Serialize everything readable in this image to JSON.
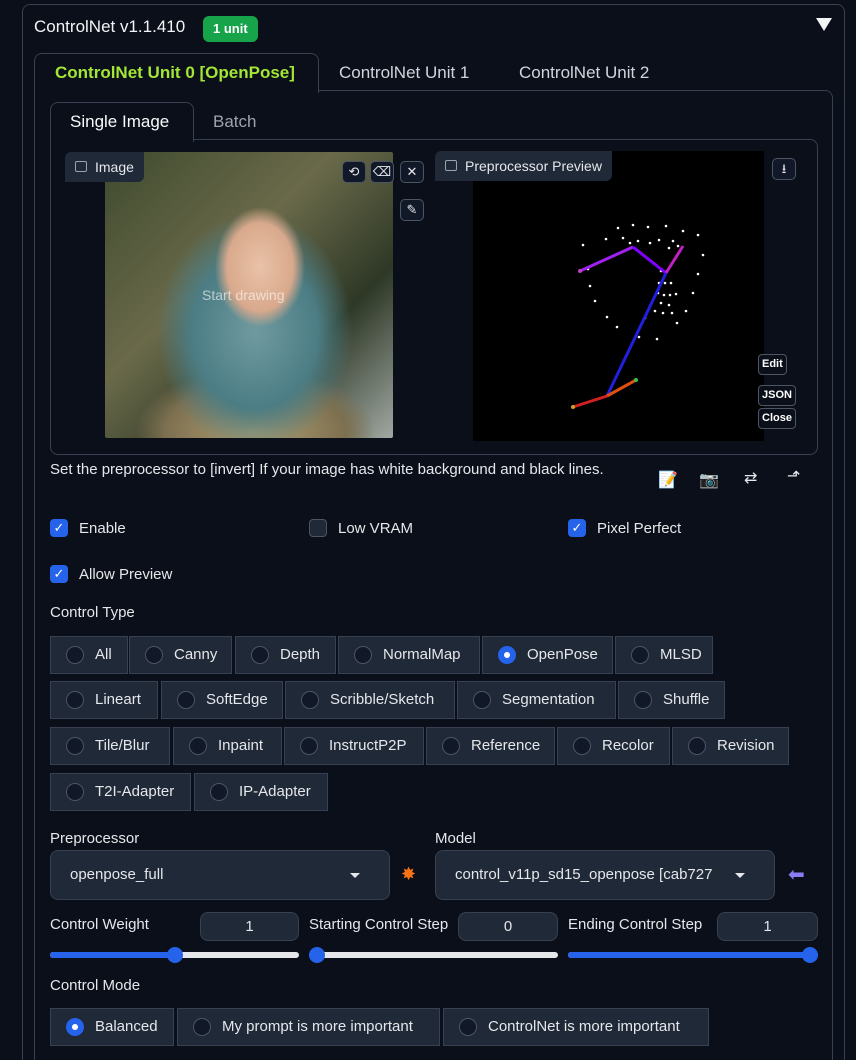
{
  "header": {
    "title": "ControlNet v1.1.410",
    "badge": "1 unit"
  },
  "unit_tabs": [
    "ControlNet Unit 0 [OpenPose]",
    "ControlNet Unit 1",
    "ControlNet Unit 2"
  ],
  "image_tabs": [
    "Single Image",
    "Batch"
  ],
  "image_panel": {
    "label": "Image",
    "overlay": "Start drawing"
  },
  "preview_panel": {
    "label": "Preprocessor Preview",
    "edit": "Edit",
    "json": "JSON",
    "close": "Close"
  },
  "hint": "Set the preprocessor to [invert] If your image has white background and black lines.",
  "options": {
    "enable": {
      "label": "Enable",
      "checked": true
    },
    "low_vram": {
      "label": "Low VRAM",
      "checked": false
    },
    "pixel_perfect": {
      "label": "Pixel Perfect",
      "checked": true
    },
    "allow_preview": {
      "label": "Allow Preview",
      "checked": true
    }
  },
  "control_type": {
    "label": "Control Type",
    "selected": "OpenPose",
    "rows": [
      [
        "All",
        "Canny",
        "Depth",
        "NormalMap",
        "OpenPose",
        "MLSD"
      ],
      [
        "Lineart",
        "SoftEdge",
        "Scribble/Sketch",
        "Segmentation",
        "Shuffle"
      ],
      [
        "Tile/Blur",
        "Inpaint",
        "InstructP2P",
        "Reference",
        "Recolor",
        "Revision"
      ],
      [
        "T2I-Adapter",
        "IP-Adapter"
      ]
    ]
  },
  "preprocessor": {
    "label": "Preprocessor",
    "value": "openpose_full"
  },
  "model": {
    "label": "Model",
    "value": "control_v11p_sd15_openpose [cab727"
  },
  "weights": {
    "control_weight": {
      "label": "Control Weight",
      "value": "1",
      "fraction": 0.5
    },
    "start_step": {
      "label": "Starting Control Step",
      "value": "0",
      "fraction": 0.0
    },
    "end_step": {
      "label": "Ending Control Step",
      "value": "1",
      "fraction": 1.0
    }
  },
  "control_mode": {
    "label": "Control Mode",
    "selected": "Balanced",
    "options": [
      "Balanced",
      "My prompt is more important",
      "ControlNet is more important"
    ]
  },
  "colors": {
    "accent": "#2563eb",
    "active_tab": "#a3e635",
    "badge": "#16a34a"
  }
}
